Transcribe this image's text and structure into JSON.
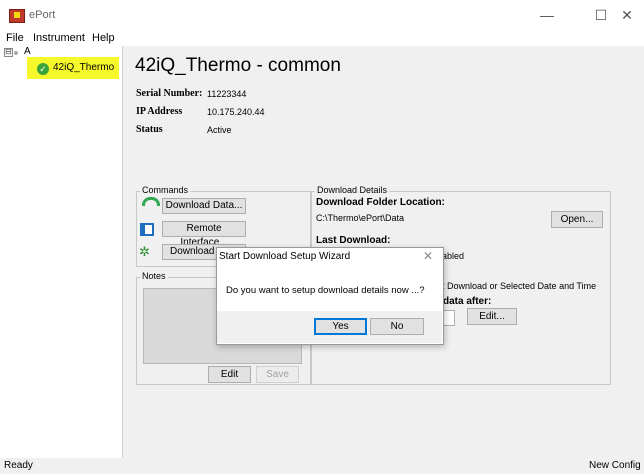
{
  "window": {
    "title": "ePort",
    "minimize_glyph": "—",
    "maximize_glyph": "☐",
    "close_glyph": "✕"
  },
  "menu": [
    "File",
    "Instrument",
    "Help"
  ],
  "tree": {
    "root_label": "A",
    "toggle_glyph": "⊟",
    "node_label": "42iQ_Thermo",
    "node_check": "✓",
    "highlight_color": "#f6f72a"
  },
  "main": {
    "title": "42iQ_Thermo  - common",
    "info": [
      {
        "label": "Serial Number:",
        "value": "11223344"
      },
      {
        "label": "IP Address",
        "value": "10.175.240.44"
      },
      {
        "label": "Status",
        "value": "Active"
      }
    ]
  },
  "commands": {
    "group_title": "Commands",
    "download_data": "Download Data...",
    "remote_interface": "Remote Interface...",
    "download_setup": "Download Se",
    "setup_glyph": "✲"
  },
  "notes": {
    "group_title": "Notes",
    "edit": "Edit",
    "save": "Save"
  },
  "details": {
    "group_title": "Download Details",
    "folder_label": "Download Folder Location:",
    "folder_path": "C:\\Thermo\\ePort\\Data",
    "open": "Open...",
    "last_label": "Last Download:",
    "enabled_text": "abled",
    "option_text": "t Download or Selected Date and Time",
    "after_label": "data after:",
    "edit": "Edit..."
  },
  "dialog": {
    "title": "Start Download Setup Wizard",
    "close_glyph": "✕",
    "message": "Do you want to setup download details now ...?",
    "yes": "Yes",
    "no": "No"
  },
  "status": {
    "left": "Ready",
    "right": "New Config ."
  }
}
